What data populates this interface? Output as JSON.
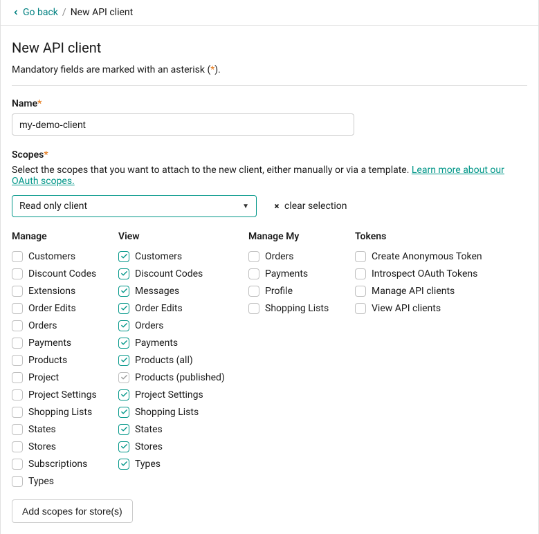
{
  "breadcrumb": {
    "back_label": "Go back",
    "current": "New API client"
  },
  "page": {
    "title": "New API client",
    "hint_before": "Mandatory fields are marked with an asterisk (",
    "hint_asterisk": "*",
    "hint_after": ")."
  },
  "name_field": {
    "label": "Name",
    "value": "my-demo-client"
  },
  "scopes": {
    "label": "Scopes",
    "hint_before": "Select the scopes that you want to attach to the new client, either manually or via a template. ",
    "learn_more": "Learn more about our OAuth scopes.",
    "template_value": "Read only client",
    "clear_label": "clear selection"
  },
  "columns": {
    "manage": {
      "header": "Manage",
      "items": [
        {
          "label": "Customers",
          "checked": false
        },
        {
          "label": "Discount Codes",
          "checked": false
        },
        {
          "label": "Extensions",
          "checked": false
        },
        {
          "label": "Order Edits",
          "checked": false
        },
        {
          "label": "Orders",
          "checked": false
        },
        {
          "label": "Payments",
          "checked": false
        },
        {
          "label": "Products",
          "checked": false
        },
        {
          "label": "Project",
          "checked": false
        },
        {
          "label": "Project Settings",
          "checked": false
        },
        {
          "label": "Shopping Lists",
          "checked": false
        },
        {
          "label": "States",
          "checked": false
        },
        {
          "label": "Stores",
          "checked": false
        },
        {
          "label": "Subscriptions",
          "checked": false
        },
        {
          "label": "Types",
          "checked": false
        }
      ]
    },
    "view": {
      "header": "View",
      "items": [
        {
          "label": "Customers",
          "checked": true
        },
        {
          "label": "Discount Codes",
          "checked": true
        },
        {
          "label": "Messages",
          "checked": true
        },
        {
          "label": "Order Edits",
          "checked": true
        },
        {
          "label": "Orders",
          "checked": true
        },
        {
          "label": "Payments",
          "checked": true
        },
        {
          "label": "Products (all)",
          "checked": true
        },
        {
          "label": "Products (published)",
          "checked": true,
          "disabled": true
        },
        {
          "label": "Project Settings",
          "checked": true
        },
        {
          "label": "Shopping Lists",
          "checked": true
        },
        {
          "label": "States",
          "checked": true
        },
        {
          "label": "Stores",
          "checked": true
        },
        {
          "label": "Types",
          "checked": true
        }
      ]
    },
    "managemy": {
      "header": "Manage My",
      "items": [
        {
          "label": "Orders",
          "checked": false
        },
        {
          "label": "Payments",
          "checked": false
        },
        {
          "label": "Profile",
          "checked": false
        },
        {
          "label": "Shopping Lists",
          "checked": false
        }
      ]
    },
    "tokens": {
      "header": "Tokens",
      "items": [
        {
          "label": "Create Anonymous Token",
          "checked": false
        },
        {
          "label": "Introspect OAuth Tokens",
          "checked": false
        },
        {
          "label": "Manage API clients",
          "checked": false
        },
        {
          "label": "View API clients",
          "checked": false
        }
      ]
    }
  },
  "add_stores_label": "Add scopes for store(s)"
}
